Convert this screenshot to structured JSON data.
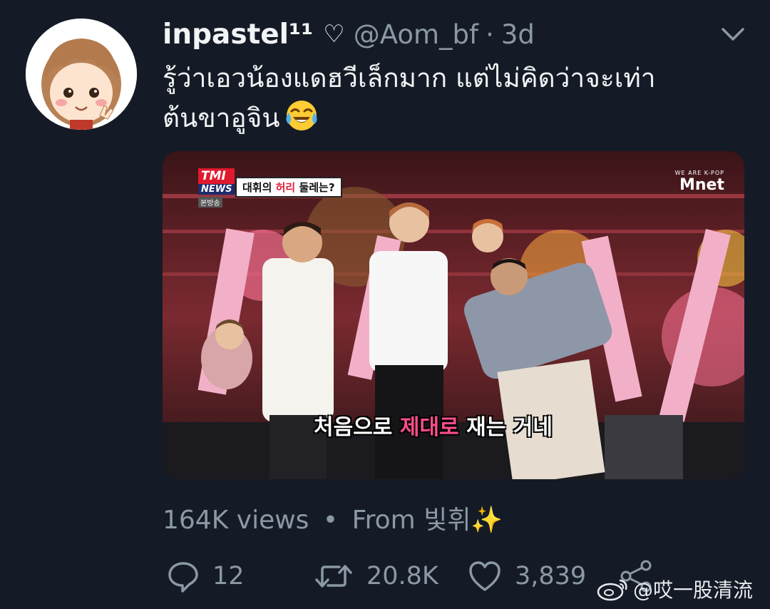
{
  "tweet": {
    "display_name": "inpastel¹¹",
    "name_icon": "heart-outline-icon",
    "handle": "@Aom_bf",
    "separator": "·",
    "time": "3d",
    "text_lines": [
      "รู้ว่าเอวน้องแดฮวีเล็กมาก แต่ไม่คิดว่าจะเท่า",
      "ต้นขาอูจิน"
    ],
    "emoji": "face-with-tears-of-joy-icon"
  },
  "media": {
    "badge_top": "TMI",
    "badge_bottom": "NEWS",
    "badge_sub": "본방송",
    "topic_prefix": "대휘의 ",
    "topic_highlight": "허리",
    "topic_suffix": " 둘레는?",
    "broadcaster_small": "WE ARE K-POP",
    "broadcaster": "Mnet",
    "subtitle_white": "처음으로 ",
    "subtitle_pink": "제대로",
    "subtitle_end": " 재는 거네"
  },
  "stats": {
    "views": "164K views",
    "dot": "•",
    "from": "From 빛휘✨"
  },
  "actions": {
    "reply_count": "12",
    "retweet_count": "20.8K",
    "like_count": "3,839"
  },
  "watermark": {
    "text": "@哎一股清流"
  },
  "colors": {
    "background": "#151b26",
    "secondary_text": "#8b98a5",
    "primary_text": "#f1f3f4"
  }
}
